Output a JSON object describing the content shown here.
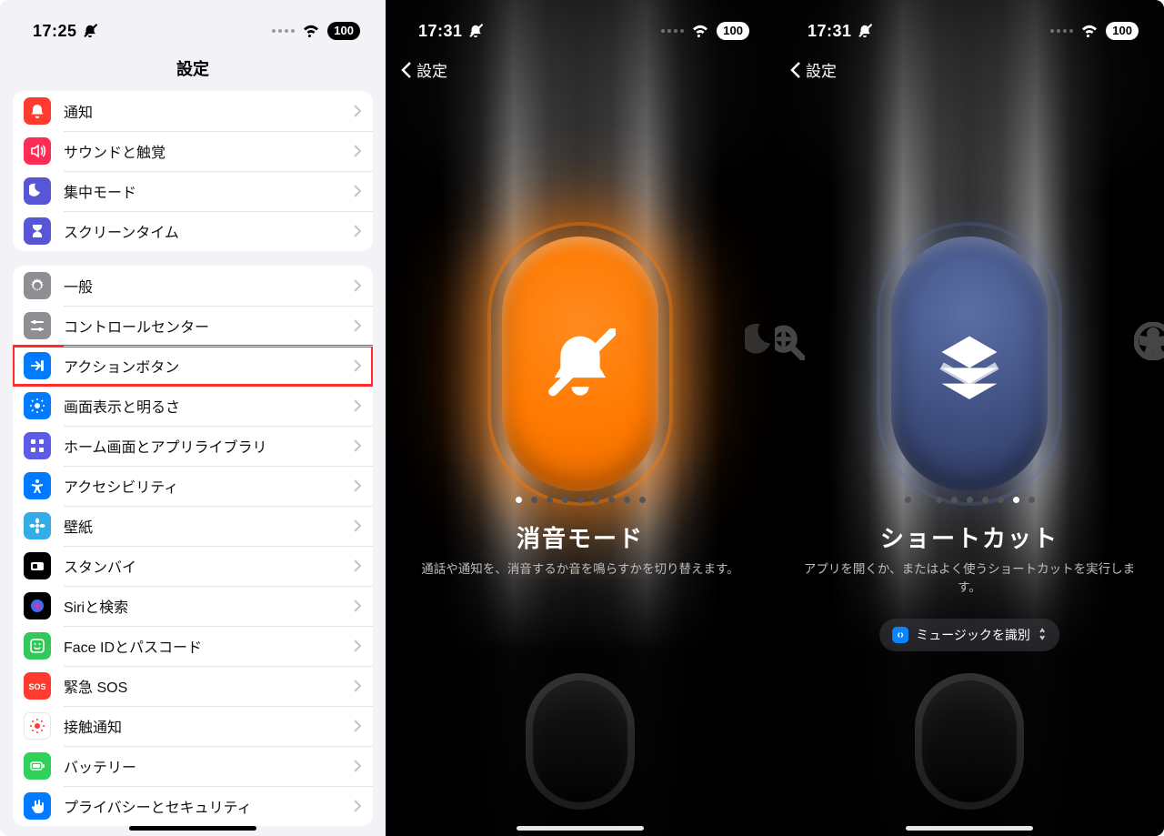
{
  "left": {
    "status": {
      "time": "17:25",
      "battery": "100"
    },
    "title": "設定",
    "group1": [
      {
        "id": "notifications",
        "label": "通知",
        "bg": "bg-red",
        "icon": "bell"
      },
      {
        "id": "sounds",
        "label": "サウンドと触覚",
        "bg": "bg-pink",
        "icon": "speaker"
      },
      {
        "id": "focus",
        "label": "集中モード",
        "bg": "bg-indigo",
        "icon": "moon"
      },
      {
        "id": "screentime",
        "label": "スクリーンタイム",
        "bg": "bg-indigo",
        "icon": "hourglass"
      }
    ],
    "group2": [
      {
        "id": "general",
        "label": "一般",
        "bg": "bg-gray",
        "icon": "gear"
      },
      {
        "id": "controlcenter",
        "label": "コントロールセンター",
        "bg": "bg-gray2",
        "icon": "sliders"
      },
      {
        "id": "actionbutton",
        "label": "アクションボタン",
        "bg": "bg-blue",
        "icon": "action",
        "highlight": true
      },
      {
        "id": "display",
        "label": "画面表示と明るさ",
        "bg": "bg-blue",
        "icon": "sun"
      },
      {
        "id": "homescreen",
        "label": "ホーム画面とアプリライブラリ",
        "bg": "bg-purple",
        "icon": "grid"
      },
      {
        "id": "accessibility",
        "label": "アクセシビリティ",
        "bg": "bg-blue",
        "icon": "access"
      },
      {
        "id": "wallpaper",
        "label": "壁紙",
        "bg": "bg-cyan",
        "icon": "flower"
      },
      {
        "id": "standby",
        "label": "スタンバイ",
        "bg": "bg-black",
        "icon": "standby"
      },
      {
        "id": "siri",
        "label": "Siriと検索",
        "bg": "bg-black",
        "icon": "siri"
      },
      {
        "id": "faceid",
        "label": "Face IDとパスコード",
        "bg": "bg-green",
        "icon": "faceid"
      },
      {
        "id": "sos",
        "label": "緊急 SOS",
        "bg": "bg-sos",
        "icon": "sos"
      },
      {
        "id": "exposure",
        "label": "接触通知",
        "bg": "bg-white",
        "icon": "exposure"
      },
      {
        "id": "battery",
        "label": "バッテリー",
        "bg": "bg-tint",
        "icon": "battery"
      },
      {
        "id": "privacy",
        "label": "プライバシーとセキュリティ",
        "bg": "bg-blue",
        "icon": "hand"
      }
    ]
  },
  "mid": {
    "status": {
      "time": "17:31",
      "battery": "100"
    },
    "back_label": "設定",
    "page_dots": {
      "total": 9,
      "active": 0
    },
    "mode_title": "消音モード",
    "mode_desc": "通話や通知を、消音するか音を鳴らすかを切り替えます。"
  },
  "right": {
    "status": {
      "time": "17:31",
      "battery": "100"
    },
    "back_label": "設定",
    "page_dots": {
      "total": 9,
      "active": 7
    },
    "mode_title": "ショートカット",
    "mode_desc": "アプリを開くか、またはよく使うショートカットを実行します。",
    "chip_label": "ミュージックを識別"
  }
}
